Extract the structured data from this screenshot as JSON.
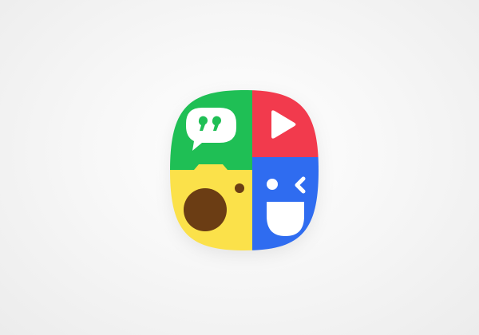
{
  "app_icon": {
    "name": "photo-grid-app-icon",
    "quadrants": [
      {
        "icon": "quote-bubble-icon",
        "color": "#1fbf55"
      },
      {
        "icon": "play-icon",
        "color": "#f23a4d"
      },
      {
        "icon": "camera-lens-icon",
        "color": "#fbe14a"
      },
      {
        "icon": "winking-face-icon",
        "color": "#2f6cf0"
      }
    ],
    "glyph_colors": {
      "white": "#ffffff",
      "lens": "#6b3d14",
      "camera_dot": "#6b3d14"
    }
  }
}
